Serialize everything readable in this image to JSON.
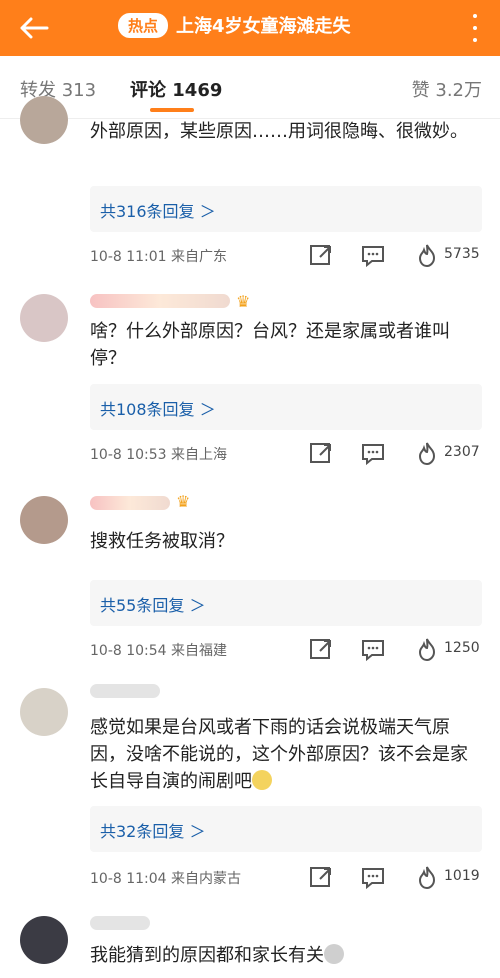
{
  "header": {
    "hot_label": "热点",
    "title": "上海4岁女童海滩走失",
    "accent": "#ff7f1a"
  },
  "tabs": {
    "repost": "转发 313",
    "comment": "评论 1469",
    "like": "赞 3.2万"
  },
  "comments": [
    {
      "text": "外部原因，某些原因……用词很隐晦、很微妙。",
      "replies": "共316条回复 ＞",
      "meta": "10-8 11:01  来自广东",
      "likes": "5735"
    },
    {
      "text": "啥？什么外部原因？台风？还是家属或者谁叫停？",
      "replies": "共108条回复 ＞",
      "meta": "10-8 10:53  来自上海",
      "likes": "2307"
    },
    {
      "text": "搜救任务被取消？",
      "replies": "共55条回复 ＞",
      "meta": "10-8 10:54  来自福建",
      "likes": "1250"
    },
    {
      "text": "感觉如果是台风或者下雨的话会说极端天气原因，没啥不能说的，这个外部原因？该不会是家长自导自演的闹剧吧",
      "replies": "共32条回复 ＞",
      "meta": "10-8 11:04  来自内蒙古",
      "likes": "1019"
    },
    {
      "text": "我能猜到的原因都和家长有关"
    }
  ]
}
